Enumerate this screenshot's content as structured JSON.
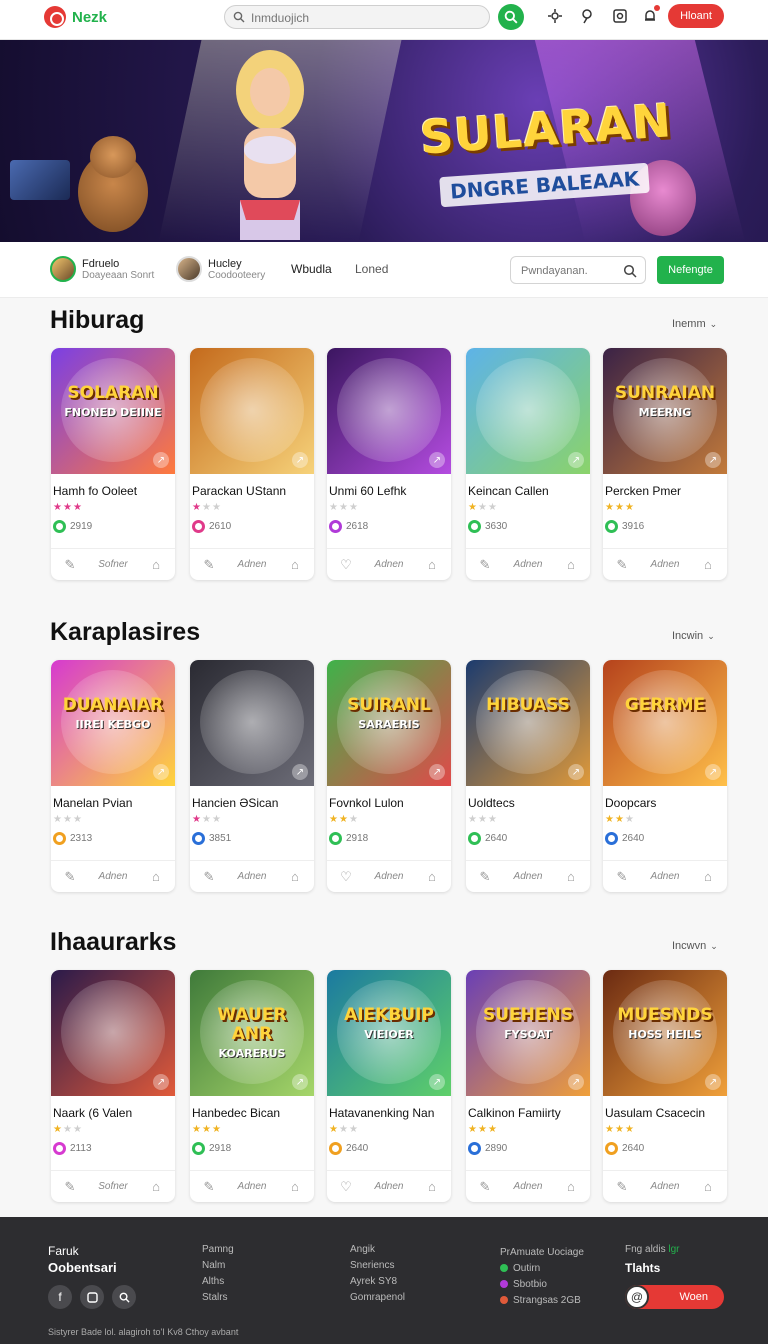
{
  "topnav": {
    "brand": "Nezk",
    "search_placeholder": "Inmduojich",
    "cta": "Hloant"
  },
  "hero": {
    "title": "SULARAN",
    "subtitle": "DNGRE BALEAAK"
  },
  "filterbar": {
    "profiles": [
      {
        "name": "Fdruelo",
        "sub": "Doayeaan Sonrt"
      },
      {
        "name": "Hucley",
        "sub": "Coodooteery"
      }
    ],
    "tabs": [
      "Wbudla",
      "Loned"
    ],
    "search_placeholder": "Pwndayanan.",
    "cta": "Nefengte"
  },
  "sections": [
    {
      "title": "Hiburag",
      "more": "Inemm",
      "cards": [
        {
          "art": "SOLARAN",
          "art_sub": "FNONED DEIINE",
          "name": "Hamh fo Ooleet",
          "stars": 3,
          "star_color": "#e03a8a",
          "badge_color": "#2fbf55",
          "count": "2919",
          "action": "Sofner",
          "like_icon": "edit-icon",
          "bg1": "#7b3fe4",
          "bg2": "#ff7a3d"
        },
        {
          "art": "",
          "art_sub": "",
          "name": "Parackan UStann",
          "stars": 1,
          "star_color": "#e03a8a",
          "badge_color": "#e03a8a",
          "count": "2610",
          "action": "Adnen",
          "like_icon": "edit-icon",
          "bg1": "#c46a1c",
          "bg2": "#f6d27a"
        },
        {
          "art": "",
          "art_sub": "",
          "name": "Unmi 60 Lefhk",
          "stars": 0,
          "star_color": "#e03a8a",
          "badge_color": "#b03ad8",
          "count": "2618",
          "action": "Adnen",
          "like_icon": "heart-icon",
          "bg1": "#3b1660",
          "bg2": "#b44ce0"
        },
        {
          "art": "",
          "art_sub": "",
          "name": "Keincan Callen",
          "stars": 1,
          "star_color": "#f0b323",
          "badge_color": "#2fbf55",
          "count": "3630",
          "action": "Adnen",
          "like_icon": "edit-icon",
          "bg1": "#5db3e8",
          "bg2": "#8bd36a"
        },
        {
          "art": "SUNRAIAN",
          "art_sub": "MEERNG",
          "name": "Percken Pmer",
          "stars": 3,
          "star_color": "#f0b323",
          "badge_color": "#2fbf55",
          "count": "3916",
          "action": "Adnen",
          "like_icon": "edit-icon",
          "bg1": "#3a2246",
          "bg2": "#c27a3a"
        }
      ]
    },
    {
      "title": "Karaplasires",
      "more": "Incwin",
      "cards": [
        {
          "art": "DUANAIAR",
          "art_sub": "IIREI KEBGO",
          "name": "Manelan Pvian",
          "stars": 0,
          "star_color": "#e03a8a",
          "badge_color": "#f0a020",
          "count": "2313",
          "action": "Adnen",
          "like_icon": "edit-icon",
          "bg1": "#d63ad0",
          "bg2": "#ffd43b"
        },
        {
          "art": "",
          "art_sub": "",
          "name": "Hancien ƏSican",
          "stars": 1,
          "star_color": "#e03a8a",
          "badge_color": "#2a6fd8",
          "count": "3851",
          "action": "Adnen",
          "like_icon": "edit-icon",
          "bg1": "#2a2a32",
          "bg2": "#6d6d78"
        },
        {
          "art": "SUIRANL",
          "art_sub": "SARAERIS",
          "name": "Fovnkol Lulon",
          "stars": 2,
          "star_color": "#f0b323",
          "badge_color": "#2fbf55",
          "count": "2918",
          "action": "Adnen",
          "like_icon": "heart-icon",
          "bg1": "#3fb24a",
          "bg2": "#e04a4a"
        },
        {
          "art": "HIBUASS",
          "art_sub": "",
          "name": "Uoldtecs",
          "stars": 0,
          "star_color": "#e03a8a",
          "badge_color": "#2fbf55",
          "count": "2640",
          "action": "Adnen",
          "like_icon": "edit-icon",
          "bg1": "#1c3b6e",
          "bg2": "#e09a3a"
        },
        {
          "art": "GERRME",
          "art_sub": "",
          "name": "Doopcars",
          "stars": 2,
          "star_color": "#f0b323",
          "badge_color": "#2a6fd8",
          "count": "2640",
          "action": "Adnen",
          "like_icon": "edit-icon",
          "bg1": "#b5421c",
          "bg2": "#ffc04a"
        }
      ]
    },
    {
      "title": "Ihaaurarks",
      "more": "Incwvn",
      "cards": [
        {
          "art": "",
          "art_sub": "",
          "name": "Naark (6 Valen",
          "stars": 1,
          "star_color": "#f0b323",
          "badge_color": "#d63ad0",
          "count": "2113",
          "action": "Sofner",
          "like_icon": "edit-icon",
          "bg1": "#2a1a4a",
          "bg2": "#e05a3a"
        },
        {
          "art": "WAUER ANR",
          "art_sub": "KOARERUS",
          "name": "Hanbedec Bican",
          "stars": 3,
          "star_color": "#f0b323",
          "badge_color": "#2fbf55",
          "count": "2918",
          "action": "Adnen",
          "like_icon": "edit-icon",
          "bg1": "#3f7a3a",
          "bg2": "#a6d66a"
        },
        {
          "art": "AIEKBUIP",
          "art_sub": "VIEIOER",
          "name": "Hatavanenking Nan",
          "stars": 1,
          "star_color": "#f0b323",
          "badge_color": "#f0a020",
          "count": "2640",
          "action": "Adnen",
          "like_icon": "heart-icon",
          "bg1": "#1b7aa0",
          "bg2": "#5fd06a"
        },
        {
          "art": "SUEHENS",
          "art_sub": "FYSOAT",
          "name": "Calkinon Famiirty",
          "stars": 3,
          "star_color": "#f0b323",
          "badge_color": "#2a6fd8",
          "count": "2890",
          "action": "Adnen",
          "like_icon": "edit-icon",
          "bg1": "#6a3fb5",
          "bg2": "#f0a03a"
        },
        {
          "art": "MUESNDS",
          "art_sub": "HOSS HEILS",
          "name": "Uasulam Csacecin",
          "stars": 3,
          "star_color": "#f0b323",
          "badge_color": "#f0a020",
          "count": "2640",
          "action": "Adnen",
          "like_icon": "edit-icon",
          "bg1": "#6b2a12",
          "bg2": "#f0a03a"
        }
      ]
    }
  ],
  "footer": {
    "brand1": "Faruk",
    "brand2": "Oobentsari",
    "col1": [
      "Pamng",
      "Nalm",
      "Alths",
      "Stalrs"
    ],
    "col2": [
      "Angik",
      "Sneriencs",
      "Ayrek SY8",
      "Gomrapenol"
    ],
    "col3_head": "PrAmuate Uociage",
    "col3": [
      {
        "label": "Outirn",
        "color": "#2fbf55"
      },
      {
        "label": "Sbotbio",
        "color": "#b03ad8"
      },
      {
        "label": "Strangsas 2GB",
        "color": "#e05a3a"
      }
    ],
    "col4_head": "Fng aldis",
    "col4_head_accent": "lgr",
    "col4_title": "Tlahts",
    "cta": "Woen",
    "copyright": "Sistyrer Bade lol. alagiroh to'I Kv8 Cthoy avbant"
  }
}
